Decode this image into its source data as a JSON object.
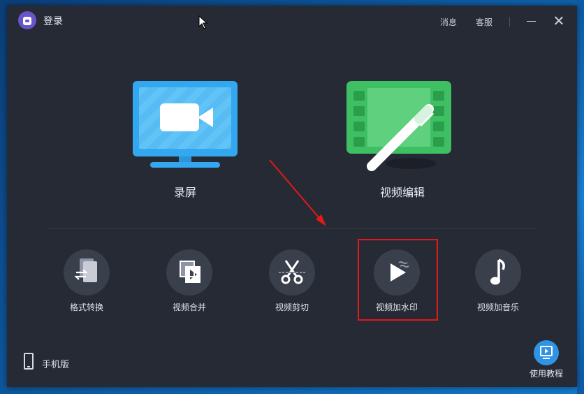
{
  "titlebar": {
    "login_label": "登录",
    "messages_label": "消息",
    "support_label": "客服"
  },
  "main_features": [
    {
      "label": "录屏",
      "icon": "screen-record-icon",
      "color": "#33a7ef"
    },
    {
      "label": "视频编辑",
      "icon": "video-edit-icon",
      "color": "#3fbf63"
    }
  ],
  "tools": [
    {
      "label": "格式转换",
      "icon": "format-convert-icon"
    },
    {
      "label": "视频合并",
      "icon": "video-merge-icon"
    },
    {
      "label": "视频剪切",
      "icon": "scissors-icon"
    },
    {
      "label": "视频加水印",
      "icon": "video-watermark-icon",
      "highlighted": true
    },
    {
      "label": "视频加音乐",
      "icon": "music-note-icon"
    }
  ],
  "footer": {
    "mobile_label": "手机版",
    "tutorial_label": "使用教程"
  },
  "colors": {
    "window_bg": "#262a35",
    "highlight_border": "#e01919",
    "annotation_arrow": "#e01919"
  }
}
